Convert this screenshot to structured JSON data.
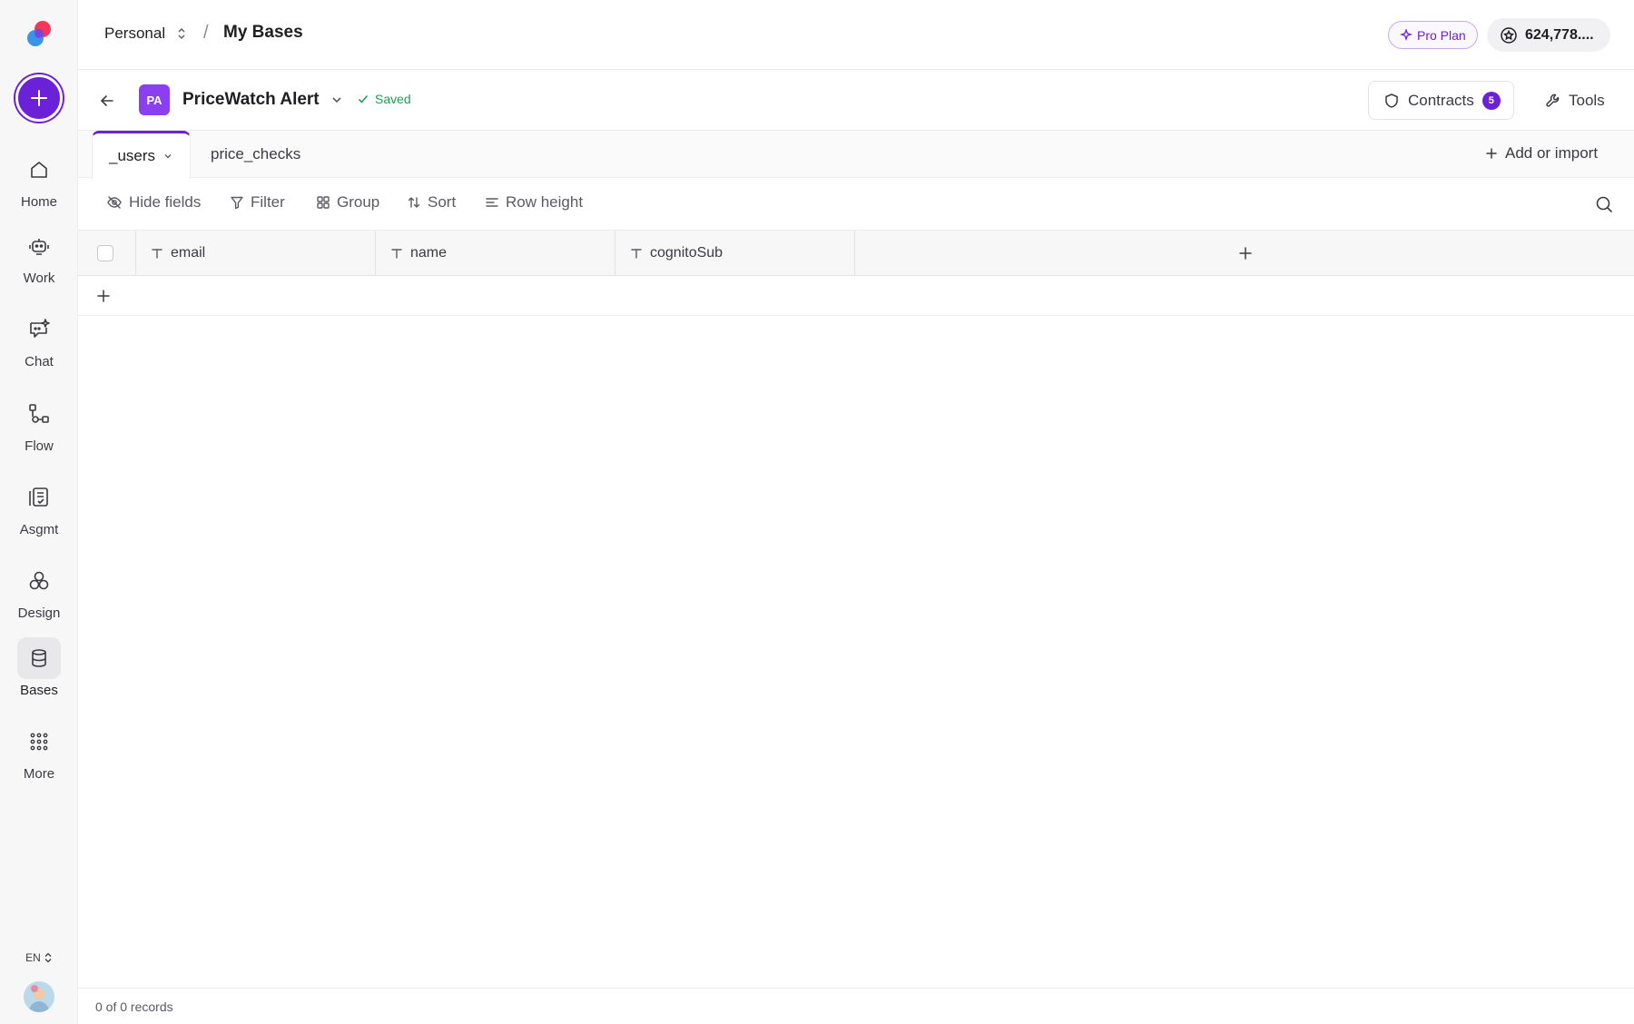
{
  "sidebar": {
    "items": [
      {
        "label": "Home",
        "icon": "home-icon"
      },
      {
        "label": "Work",
        "icon": "robot-icon"
      },
      {
        "label": "Chat",
        "icon": "chat-sparkle-icon"
      },
      {
        "label": "Flow",
        "icon": "flow-icon"
      },
      {
        "label": "Asgmt",
        "icon": "assignment-icon"
      },
      {
        "label": "Design",
        "icon": "design-icon"
      },
      {
        "label": "Bases",
        "icon": "database-icon",
        "active": true
      },
      {
        "label": "More",
        "icon": "grid-dots-icon"
      }
    ],
    "language": "EN"
  },
  "topbar": {
    "workspace": "Personal",
    "separator": "/",
    "page": "My Bases",
    "plan_label": "Pro Plan",
    "credits": "624,778...."
  },
  "base": {
    "badge": "PA",
    "name": "PriceWatch Alert",
    "status": "Saved",
    "contracts_label": "Contracts",
    "contracts_count": "5",
    "tools_label": "Tools"
  },
  "tables": {
    "tabs": [
      {
        "label": "_users",
        "active": true
      },
      {
        "label": "price_checks",
        "active": false
      }
    ],
    "add_label": "Add or import"
  },
  "toolbar": {
    "hide_fields": "Hide fields",
    "filter": "Filter",
    "group": "Group",
    "sort": "Sort",
    "row_height": "Row height"
  },
  "grid": {
    "columns": [
      {
        "name": "email",
        "type_icon": "text-type-icon"
      },
      {
        "name": "name",
        "type_icon": "text-type-icon"
      },
      {
        "name": "cognitoSub",
        "type_icon": "text-type-icon"
      }
    ]
  },
  "footer": {
    "records": "0 of 0 records"
  },
  "colors": {
    "accent": "#6b21d8",
    "badge": "#8b3ff0",
    "saved": "#1f9d55"
  }
}
